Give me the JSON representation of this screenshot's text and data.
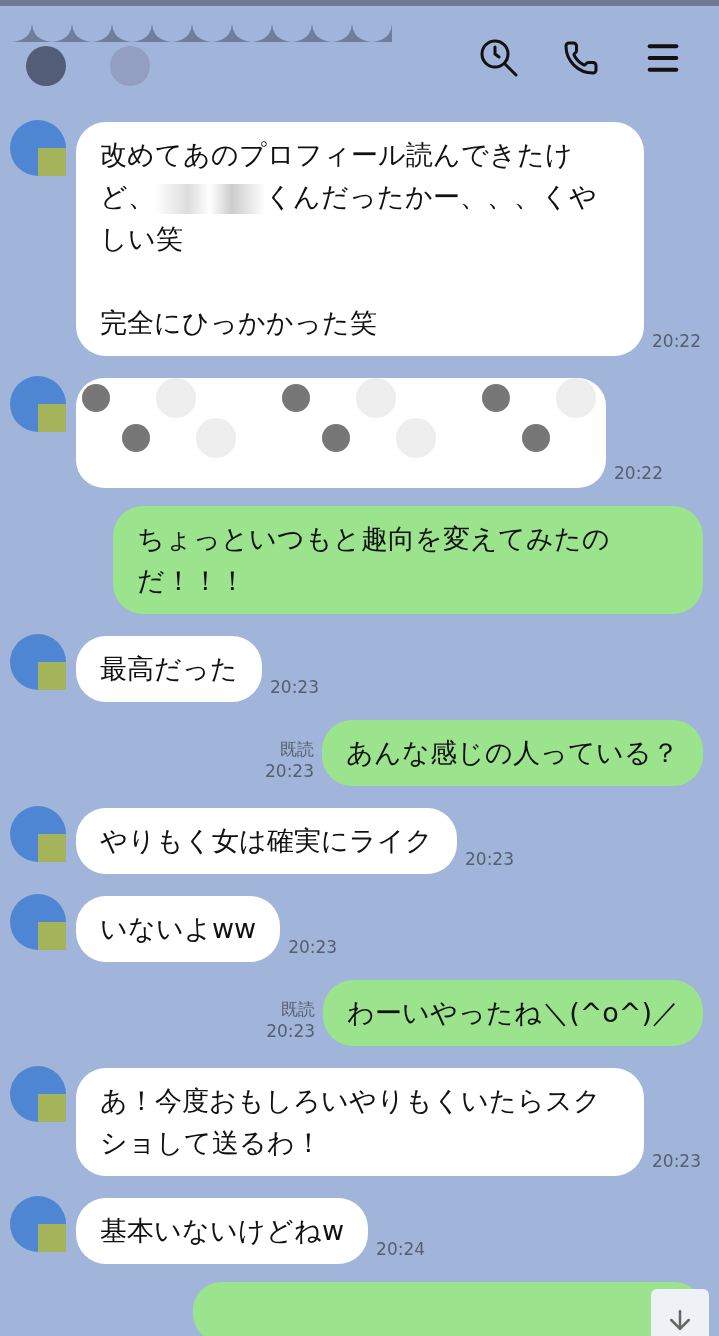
{
  "messages": [
    {
      "outgoing": false,
      "kind": "text",
      "paragraphs": [
        [
          {
            "kind": "text",
            "text": "改めてあのプロフィール読んできたけど、"
          },
          {
            "kind": "censored"
          },
          {
            "kind": "text",
            "text": "くんだったかー、、、くやしい笑"
          }
        ],
        [
          {
            "kind": "text",
            "text": "完全にひっかかった笑"
          }
        ]
      ],
      "time": "20:22"
    },
    {
      "outgoing": false,
      "kind": "censored",
      "time": "20:22"
    },
    {
      "outgoing": true,
      "kind": "text",
      "paragraphs": [
        [
          {
            "kind": "text",
            "text": "ちょっといつもと趣向を変えてみたのだ！！！"
          }
        ]
      ]
    },
    {
      "outgoing": false,
      "kind": "text",
      "paragraphs": [
        [
          {
            "kind": "text",
            "text": "最高だった"
          }
        ]
      ],
      "time": "20:23"
    },
    {
      "outgoing": true,
      "kind": "text",
      "paragraphs": [
        [
          {
            "kind": "text",
            "text": "あんな感じの人っている？"
          }
        ]
      ],
      "read": "既読",
      "time": "20:23"
    },
    {
      "outgoing": false,
      "kind": "text",
      "paragraphs": [
        [
          {
            "kind": "text",
            "text": "やりもく女は確実にライク"
          }
        ]
      ],
      "time": "20:23"
    },
    {
      "outgoing": false,
      "kind": "text",
      "paragraphs": [
        [
          {
            "kind": "text",
            "text": "いないよww"
          }
        ]
      ],
      "time": "20:23"
    },
    {
      "outgoing": true,
      "kind": "text",
      "paragraphs": [
        [
          {
            "kind": "text",
            "text": "わーいやったね＼(^o^)／"
          }
        ]
      ],
      "read": "既読",
      "time": "20:23"
    },
    {
      "outgoing": false,
      "kind": "text",
      "paragraphs": [
        [
          {
            "kind": "text",
            "text": "あ！今度おもしろいやりもくいたらスクショして送るわ！"
          }
        ]
      ],
      "time": "20:23"
    },
    {
      "outgoing": false,
      "kind": "text",
      "paragraphs": [
        [
          {
            "kind": "text",
            "text": "基本いないけどねw"
          }
        ]
      ],
      "time": "20:24"
    },
    {
      "outgoing": true,
      "kind": "partial"
    }
  ]
}
